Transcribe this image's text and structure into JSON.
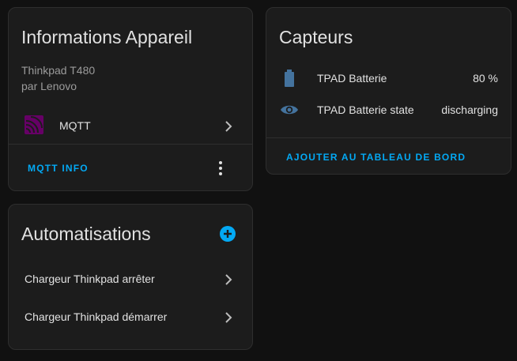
{
  "device_card": {
    "title": "Informations Appareil",
    "model": "Thinkpad T480",
    "manufacturer": "par Lenovo",
    "integration": {
      "label": "MQTT",
      "icon": "mqtt-icon"
    },
    "action_label": "MQTT INFO",
    "menu_icon": "more-vertical-icon"
  },
  "automations_card": {
    "title": "Automatisations",
    "add_icon": "plus-circle-icon",
    "items": [
      {
        "label": "Chargeur Thinkpad arrêter"
      },
      {
        "label": "Chargeur Thinkpad démarrer"
      }
    ]
  },
  "sensors_card": {
    "title": "Capteurs",
    "items": [
      {
        "icon": "battery-icon",
        "name": "TPAD Batterie",
        "value": "80 %"
      },
      {
        "icon": "eye-icon",
        "name": "TPAD Batterie state",
        "value": "discharging"
      }
    ],
    "action_label": "AJOUTER AU TABLEAU DE BORD"
  },
  "colors": {
    "accent": "#03a9f4",
    "icon_blue": "#44739e",
    "mqtt_purple": "#660066",
    "card_bg": "#1c1c1c",
    "page_bg": "#111111"
  }
}
